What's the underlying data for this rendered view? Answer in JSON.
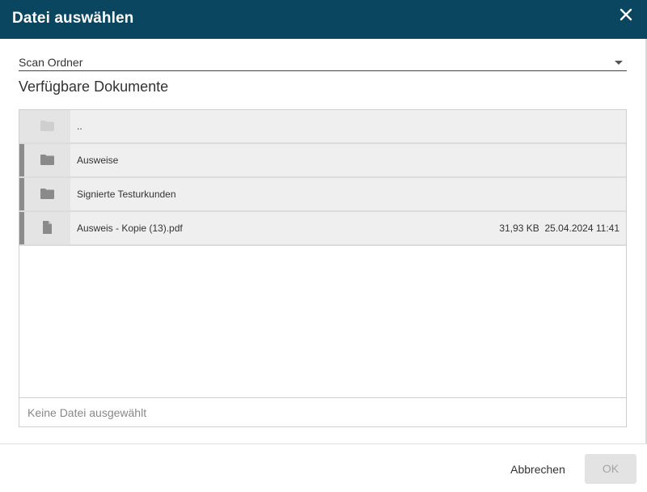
{
  "dialog": {
    "title": "Datei auswählen",
    "close_icon": "close-icon"
  },
  "folder_select": {
    "value": "Scan Ordner",
    "icon": "caret-down-icon"
  },
  "section": {
    "title": "Verfügbare Dokumente"
  },
  "files": [
    {
      "name": "..",
      "type": "folder",
      "size": "",
      "date": "",
      "icon": "folder-icon"
    },
    {
      "name": "Ausweise",
      "type": "folder",
      "size": "",
      "date": "",
      "icon": "folder-icon"
    },
    {
      "name": "Signierte Testurkunden",
      "type": "folder",
      "size": "",
      "date": "",
      "icon": "folder-icon"
    },
    {
      "name": "Ausweis - Kopie (13).pdf",
      "type": "file",
      "size": "31,93 KB",
      "date": "25.04.2024 11:41",
      "icon": "file-icon"
    }
  ],
  "status": {
    "text": "Keine Datei ausgewählt"
  },
  "footer": {
    "cancel_label": "Abbrechen",
    "ok_label": "OK",
    "ok_enabled": false
  },
  "colors": {
    "header_bg": "#0b4660",
    "row_bg": "#efefef",
    "row_accent": "#8c8c8c",
    "ok_disabled_bg": "#e3e3e3"
  }
}
